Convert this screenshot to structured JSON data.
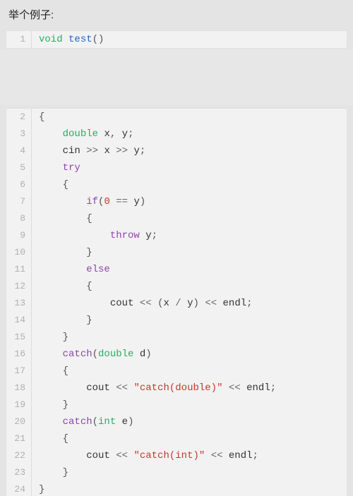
{
  "heading": "举个例子:",
  "block1": {
    "lines": [
      {
        "n": 1,
        "tokens": [
          {
            "t": "void",
            "c": "tok-type"
          },
          {
            "t": " "
          },
          {
            "t": "test",
            "c": "tok-fn"
          },
          {
            "t": "()",
            "c": "tok-punc"
          }
        ]
      }
    ]
  },
  "block2": {
    "lines": [
      {
        "n": 2,
        "indent": 0,
        "tokens": [
          {
            "t": "{",
            "c": "tok-punc"
          }
        ]
      },
      {
        "n": 3,
        "indent": 1,
        "tokens": [
          {
            "t": "double",
            "c": "tok-type"
          },
          {
            "t": " "
          },
          {
            "t": "x",
            "c": "tok-id"
          },
          {
            "t": ", ",
            "c": "tok-punc"
          },
          {
            "t": "y",
            "c": "tok-id"
          },
          {
            "t": ";",
            "c": "tok-punc"
          }
        ]
      },
      {
        "n": 4,
        "indent": 1,
        "tokens": [
          {
            "t": "cin",
            "c": "tok-id"
          },
          {
            "t": " "
          },
          {
            "t": ">>",
            "c": "tok-op"
          },
          {
            "t": " "
          },
          {
            "t": "x",
            "c": "tok-id"
          },
          {
            "t": " "
          },
          {
            "t": ">>",
            "c": "tok-op"
          },
          {
            "t": " "
          },
          {
            "t": "y",
            "c": "tok-id"
          },
          {
            "t": ";",
            "c": "tok-punc"
          }
        ]
      },
      {
        "n": 5,
        "indent": 1,
        "tokens": [
          {
            "t": "try",
            "c": "tok-kw"
          }
        ]
      },
      {
        "n": 6,
        "indent": 1,
        "tokens": [
          {
            "t": "{",
            "c": "tok-punc"
          }
        ]
      },
      {
        "n": 7,
        "indent": 2,
        "tokens": [
          {
            "t": "if",
            "c": "tok-kw"
          },
          {
            "t": "(",
            "c": "tok-punc"
          },
          {
            "t": "0",
            "c": "tok-num"
          },
          {
            "t": " "
          },
          {
            "t": "==",
            "c": "tok-op"
          },
          {
            "t": " "
          },
          {
            "t": "y",
            "c": "tok-id"
          },
          {
            "t": ")",
            "c": "tok-punc"
          }
        ]
      },
      {
        "n": 8,
        "indent": 2,
        "tokens": [
          {
            "t": "{",
            "c": "tok-punc"
          }
        ]
      },
      {
        "n": 9,
        "indent": 3,
        "tokens": [
          {
            "t": "throw",
            "c": "tok-kw"
          },
          {
            "t": " "
          },
          {
            "t": "y",
            "c": "tok-id"
          },
          {
            "t": ";",
            "c": "tok-punc"
          }
        ]
      },
      {
        "n": 10,
        "indent": 2,
        "tokens": [
          {
            "t": "}",
            "c": "tok-punc"
          }
        ]
      },
      {
        "n": 11,
        "indent": 2,
        "tokens": [
          {
            "t": "else",
            "c": "tok-kw"
          }
        ]
      },
      {
        "n": 12,
        "indent": 2,
        "tokens": [
          {
            "t": "{",
            "c": "tok-punc"
          }
        ]
      },
      {
        "n": 13,
        "indent": 3,
        "tokens": [
          {
            "t": "cout",
            "c": "tok-id"
          },
          {
            "t": " "
          },
          {
            "t": "<<",
            "c": "tok-op"
          },
          {
            "t": " "
          },
          {
            "t": "(",
            "c": "tok-punc"
          },
          {
            "t": "x",
            "c": "tok-id"
          },
          {
            "t": " "
          },
          {
            "t": "/",
            "c": "tok-op"
          },
          {
            "t": " "
          },
          {
            "t": "y",
            "c": "tok-id"
          },
          {
            "t": ")",
            "c": "tok-punc"
          },
          {
            "t": " "
          },
          {
            "t": "<<",
            "c": "tok-op"
          },
          {
            "t": " "
          },
          {
            "t": "endl",
            "c": "tok-id"
          },
          {
            "t": ";",
            "c": "tok-punc"
          }
        ]
      },
      {
        "n": 14,
        "indent": 2,
        "tokens": [
          {
            "t": "}",
            "c": "tok-punc"
          }
        ]
      },
      {
        "n": 15,
        "indent": 1,
        "tokens": [
          {
            "t": "}",
            "c": "tok-punc"
          }
        ]
      },
      {
        "n": 16,
        "indent": 1,
        "tokens": [
          {
            "t": "catch",
            "c": "tok-kw"
          },
          {
            "t": "(",
            "c": "tok-punc"
          },
          {
            "t": "double",
            "c": "tok-type"
          },
          {
            "t": " "
          },
          {
            "t": "d",
            "c": "tok-id"
          },
          {
            "t": ")",
            "c": "tok-punc"
          }
        ]
      },
      {
        "n": 17,
        "indent": 1,
        "tokens": [
          {
            "t": "{",
            "c": "tok-punc"
          }
        ]
      },
      {
        "n": 18,
        "indent": 2,
        "tokens": [
          {
            "t": "cout",
            "c": "tok-id"
          },
          {
            "t": " "
          },
          {
            "t": "<<",
            "c": "tok-op"
          },
          {
            "t": " "
          },
          {
            "t": "\"catch(double)\"",
            "c": "tok-str"
          },
          {
            "t": " "
          },
          {
            "t": "<<",
            "c": "tok-op"
          },
          {
            "t": " "
          },
          {
            "t": "endl",
            "c": "tok-id"
          },
          {
            "t": ";",
            "c": "tok-punc"
          }
        ]
      },
      {
        "n": 19,
        "indent": 1,
        "tokens": [
          {
            "t": "}",
            "c": "tok-punc"
          }
        ]
      },
      {
        "n": 20,
        "indent": 1,
        "tokens": [
          {
            "t": "catch",
            "c": "tok-kw"
          },
          {
            "t": "(",
            "c": "tok-punc"
          },
          {
            "t": "int",
            "c": "tok-type"
          },
          {
            "t": " "
          },
          {
            "t": "e",
            "c": "tok-id"
          },
          {
            "t": ")",
            "c": "tok-punc"
          }
        ]
      },
      {
        "n": 21,
        "indent": 1,
        "tokens": [
          {
            "t": "{",
            "c": "tok-punc"
          }
        ]
      },
      {
        "n": 22,
        "indent": 2,
        "tokens": [
          {
            "t": "cout",
            "c": "tok-id"
          },
          {
            "t": " "
          },
          {
            "t": "<<",
            "c": "tok-op"
          },
          {
            "t": " "
          },
          {
            "t": "\"catch(int)\"",
            "c": "tok-str"
          },
          {
            "t": " "
          },
          {
            "t": "<<",
            "c": "tok-op"
          },
          {
            "t": " "
          },
          {
            "t": "endl",
            "c": "tok-id"
          },
          {
            "t": ";",
            "c": "tok-punc"
          }
        ]
      },
      {
        "n": 23,
        "indent": 1,
        "tokens": [
          {
            "t": "}",
            "c": "tok-punc"
          }
        ]
      },
      {
        "n": 24,
        "indent": 0,
        "tokens": [
          {
            "t": "}",
            "c": "tok-punc"
          }
        ]
      }
    ]
  }
}
